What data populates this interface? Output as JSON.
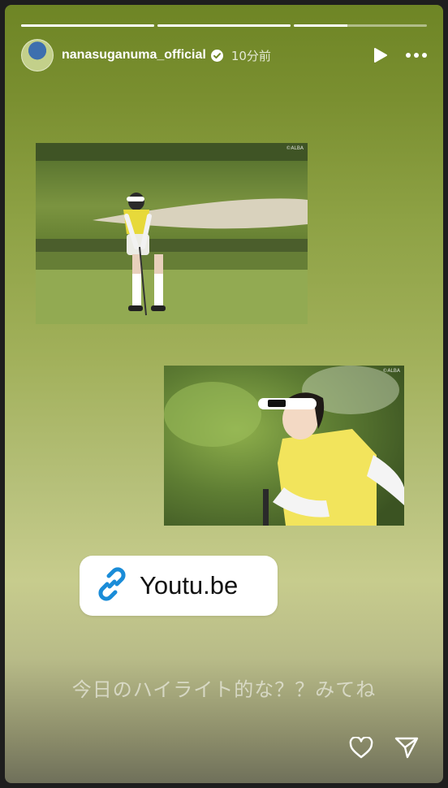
{
  "progress": {
    "segments": [
      1.0,
      1.0,
      0.4
    ]
  },
  "header": {
    "username": "nanasuganuma_official",
    "time": "10分前"
  },
  "photos": {
    "credit_1": "©ALBA",
    "credit_2": "©ALBA"
  },
  "link": {
    "label": "Youtu.be"
  },
  "caption": "今日のハイライト的な？？みてね",
  "icons": {
    "play": "play-icon",
    "more": "more-icon",
    "verified": "verified-badge-icon",
    "link": "link-icon",
    "like": "heart-icon",
    "share": "send-icon"
  },
  "colors": {
    "link_blue": "#1a8cd8",
    "top_green": "#6e8525"
  }
}
